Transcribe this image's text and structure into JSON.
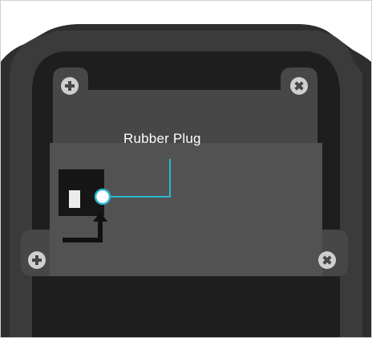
{
  "callout": {
    "label": "Rubber Plug"
  },
  "colors": {
    "background": "#ffffff",
    "housing_outer": "#2e2e2e",
    "housing_mid": "#3a3a3a",
    "housing_inner": "#1d1d1d",
    "bracket": "#474747",
    "plate": "#505050",
    "screw": "#cfcfcf",
    "plug_socket": "#161616",
    "plug_stub": "#ececec",
    "callout_line": "#2bb6cf",
    "arrow": "#111111"
  },
  "icons": {
    "screw_top_left": "phillips-screw-icon",
    "screw_top_right": "x-screw-icon",
    "screw_bottom_left": "phillips-screw-icon",
    "screw_bottom_right": "x-screw-icon",
    "arrow": "bent-up-arrow-icon"
  }
}
